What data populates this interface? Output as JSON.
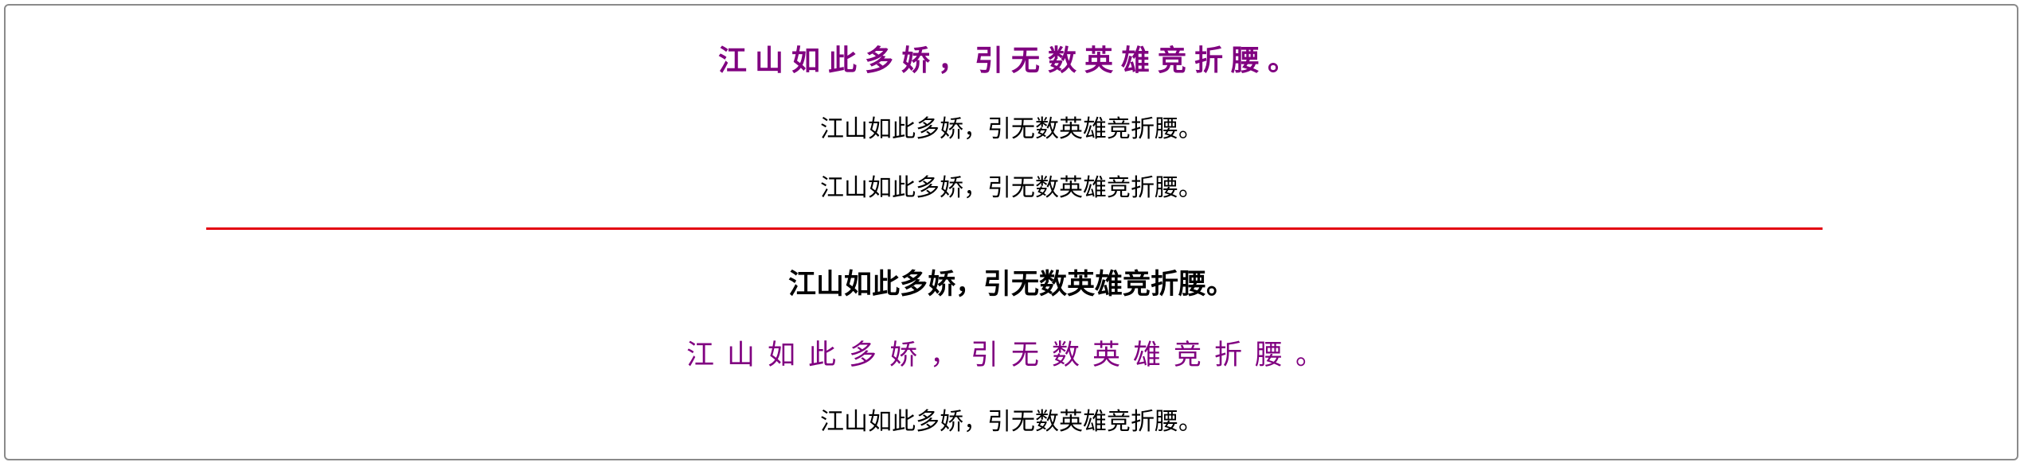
{
  "lines": {
    "line1": "江山如此多娇，引无数英雄竞折腰。",
    "line2": "江山如此多娇，引无数英雄竞折腰。",
    "line3": "江山如此多娇，引无数英雄竞折腰。",
    "line4": "江山如此多娇，引无数英雄竞折腰。",
    "line5": "江山如此多娇，引无数英雄竞折腰。",
    "line6": "江山如此多娇，引无数英雄竞折腰。"
  },
  "colors": {
    "purple_text": "#800080",
    "black_text": "#000000",
    "divider": "#e3000f",
    "frame_border": "#8a8a8a"
  }
}
